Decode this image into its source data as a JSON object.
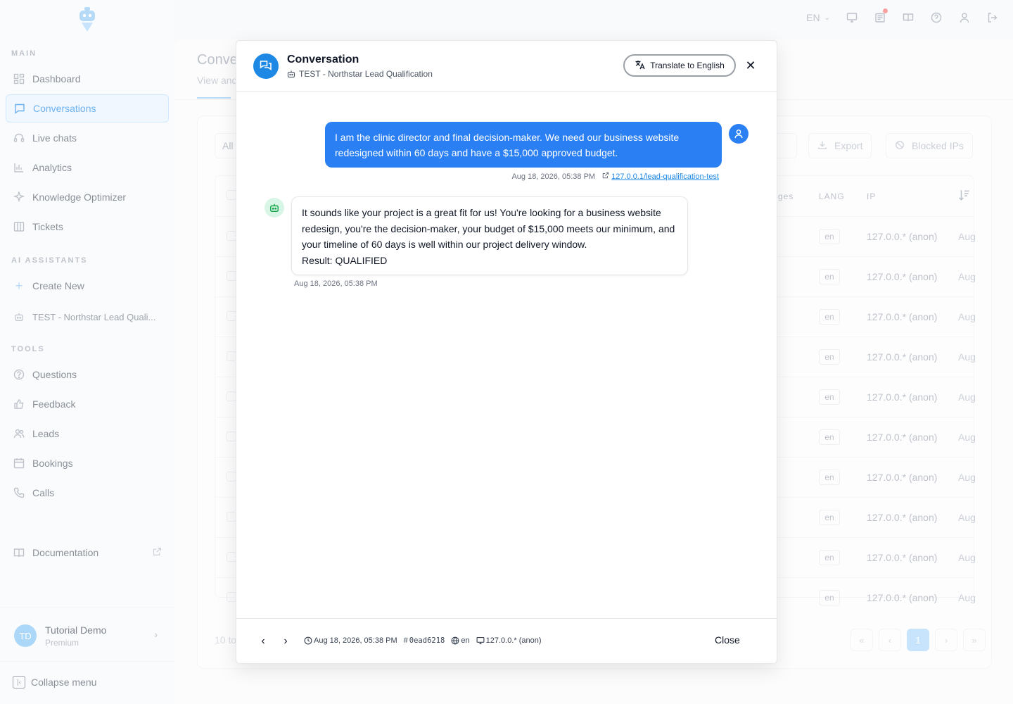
{
  "colors": {
    "accent": "#1e88e5",
    "user_bubble": "#2a7ff3",
    "bot_avatar_bg": "#d8f5e6"
  },
  "topbar": {
    "language": "EN"
  },
  "sidebar": {
    "sections": {
      "main": "MAIN",
      "assistants": "AI ASSISTANTS",
      "tools": "TOOLS"
    },
    "main_items": [
      {
        "label": "Dashboard",
        "icon": "dashboard-icon"
      },
      {
        "label": "Conversations",
        "icon": "chat-icon",
        "active": true
      },
      {
        "label": "Live chats",
        "icon": "headset-icon"
      },
      {
        "label": "Analytics",
        "icon": "bar-chart-icon"
      },
      {
        "label": "Knowledge Optimizer",
        "icon": "sparkle-icon"
      },
      {
        "label": "Tickets",
        "icon": "columns-icon"
      }
    ],
    "assistant_items": [
      {
        "label": "Create New",
        "icon": "plus-icon"
      },
      {
        "label": "TEST - Northstar Lead Quali...",
        "icon": "bot-icon"
      }
    ],
    "tool_items": [
      {
        "label": "Questions",
        "icon": "question-icon"
      },
      {
        "label": "Feedback",
        "icon": "thumbs-up-icon"
      },
      {
        "label": "Leads",
        "icon": "users-icon"
      },
      {
        "label": "Bookings",
        "icon": "calendar-icon"
      },
      {
        "label": "Calls",
        "icon": "phone-icon"
      }
    ],
    "documentation": "Documentation",
    "user": {
      "initials": "TD",
      "name": "Tutorial Demo",
      "plan": "Premium"
    },
    "collapse": "Collapse menu"
  },
  "page": {
    "title": "Conve",
    "subtitle": "View and",
    "filter_all": "All",
    "export": "Export",
    "blocked_ips": "Blocked IPs",
    "columns": {
      "messages": "ges",
      "lang": "LANG",
      "ip": "IP"
    },
    "rows": [
      {
        "lang": "en",
        "ip": "127.0.0.* (anon)",
        "date": "Aug"
      },
      {
        "lang": "en",
        "ip": "127.0.0.* (anon)",
        "date": "Aug"
      },
      {
        "lang": "en",
        "ip": "127.0.0.* (anon)",
        "date": "Aug"
      },
      {
        "lang": "en",
        "ip": "127.0.0.* (anon)",
        "date": "Aug"
      },
      {
        "lang": "en",
        "ip": "127.0.0.* (anon)",
        "date": "Aug"
      },
      {
        "lang": "en",
        "ip": "127.0.0.* (anon)",
        "date": "Aug"
      },
      {
        "lang": "en",
        "ip": "127.0.0.* (anon)",
        "date": "Aug"
      },
      {
        "lang": "en",
        "ip": "127.0.0.* (anon)",
        "date": "Aug"
      },
      {
        "lang": "en",
        "ip": "127.0.0.* (anon)",
        "date": "Aug"
      },
      {
        "lang": "en",
        "ip": "127.0.0.* (anon)",
        "date": "Aug"
      }
    ],
    "results": "10 to",
    "current_page": "1"
  },
  "modal": {
    "title": "Conversation",
    "assistant": "TEST - Northstar Lead Qualification",
    "translate_label": "Translate to English",
    "messages": {
      "user": {
        "text": "I am the clinic director and final decision-maker. We need our business website redesigned within 60 days and have a $15,000 approved budget.",
        "time": "Aug 18, 2026, 05:38 PM",
        "source": "127.0.0.1/lead-qualification-test"
      },
      "bot": {
        "text": "It sounds like your project is a great fit for us! You're looking for a business website redesign, you're the decision-maker, your budget of $15,000 meets our minimum, and your timeline of 60 days is well within our project delivery window.",
        "result": "Result: QUALIFIED",
        "time": "Aug 18, 2026, 05:38 PM"
      }
    },
    "footer": {
      "time": "Aug 18, 2026, 05:38 PM",
      "id": "0ead6218",
      "lang": "en",
      "ip": "127.0.0.* (anon)",
      "close_label": "Close"
    }
  }
}
